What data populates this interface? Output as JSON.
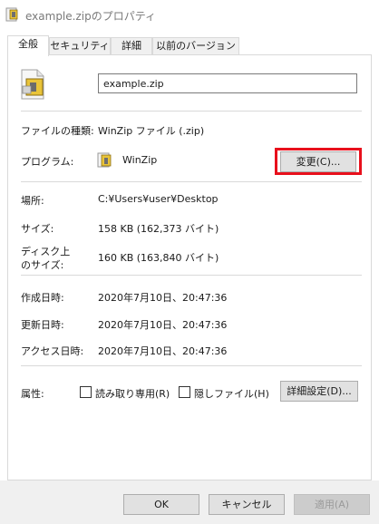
{
  "window": {
    "title": "example.zipのプロパティ",
    "icon": "winzip-file-icon"
  },
  "tabs": [
    {
      "label": "全般",
      "active": true
    },
    {
      "label": "セキュリティ",
      "active": false
    },
    {
      "label": "詳細",
      "active": false
    },
    {
      "label": "以前のバージョン",
      "active": false
    }
  ],
  "general": {
    "file_name": "example.zip",
    "file_type_label": "ファイルの種類:",
    "file_type_value": "WinZip ファイル (.zip)",
    "program_label": "プログラム:",
    "program_value": "WinZip",
    "change_button": "変更(C)...",
    "location_label": "場所:",
    "location_value": "C:¥Users¥user¥Desktop",
    "size_label": "サイズ:",
    "size_value": "158 KB (162,373 バイト)",
    "disk_size_label_line1": "ディスク上",
    "disk_size_label_line2": "のサイズ:",
    "disk_size_value": "160 KB (163,840 バイト)",
    "created_label": "作成日時:",
    "created_value": "2020年7月10日、20:47:36",
    "modified_label": "更新日時:",
    "modified_value": "2020年7月10日、20:47:36",
    "accessed_label": "アクセス日時:",
    "accessed_value": "2020年7月10日、20:47:36",
    "attributes_label": "属性:",
    "readonly_label": "読み取り専用(R)",
    "readonly_checked": false,
    "hidden_label": "隠しファイル(H)",
    "hidden_checked": false,
    "advanced_button": "詳細設定(D)..."
  },
  "footer": {
    "ok": "OK",
    "cancel": "キャンセル",
    "apply": "適用(A)"
  },
  "colors": {
    "highlight": "#e8101c",
    "button_face": "#e1e1e1",
    "border": "#d9d9d9"
  }
}
